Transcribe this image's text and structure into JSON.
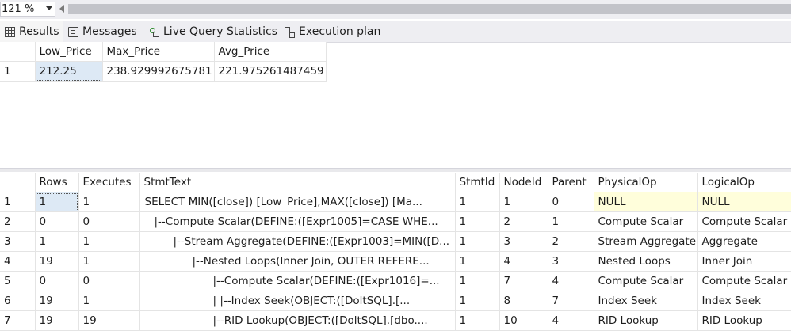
{
  "zoom": {
    "value": "121 %"
  },
  "tabs": [
    {
      "label": "Results",
      "icon": "grid-icon"
    },
    {
      "label": "Messages",
      "icon": "messages-icon"
    },
    {
      "label": "Live Query Statistics",
      "icon": "live-stats-icon"
    },
    {
      "label": "Execution plan",
      "icon": "execution-plan-icon"
    }
  ],
  "results": {
    "columns": [
      "Low_Price",
      "Max_Price",
      "Avg_Price"
    ],
    "rows": [
      {
        "num": "1",
        "cells": [
          "212.25",
          "238.929992675781",
          "221.975261487459"
        ]
      }
    ]
  },
  "plan": {
    "columns": [
      "Rows",
      "Executes",
      "StmtText",
      "StmtId",
      "NodeId",
      "Parent",
      "PhysicalOp",
      "LogicalOp"
    ],
    "rows": [
      {
        "num": "1",
        "cells": [
          "1",
          "1",
          "SELECT MIN([close]) [Low_Price],MAX([close]) [Ma...",
          "1",
          "1",
          "0",
          "NULL",
          "NULL"
        ]
      },
      {
        "num": "2",
        "cells": [
          "0",
          "0",
          "|--Compute Scalar(DEFINE:([Expr1005]=CASE WHE...",
          "1",
          "2",
          "1",
          "Compute Scalar",
          "Compute Scalar"
        ]
      },
      {
        "num": "3",
        "cells": [
          "1",
          "1",
          "|--Stream Aggregate(DEFINE:([Expr1003]=MIN([D...",
          "1",
          "3",
          "2",
          "Stream Aggregate",
          "Aggregate"
        ]
      },
      {
        "num": "4",
        "cells": [
          "19",
          "1",
          "|--Nested Loops(Inner Join, OUTER REFERE...",
          "1",
          "4",
          "3",
          "Nested Loops",
          "Inner Join"
        ]
      },
      {
        "num": "5",
        "cells": [
          "0",
          "0",
          "|--Compute Scalar(DEFINE:([Expr1016]=...",
          "1",
          "7",
          "4",
          "Compute Scalar",
          "Compute Scalar"
        ]
      },
      {
        "num": "6",
        "cells": [
          "19",
          "1",
          "|      |--Index Seek(OBJECT:([DoltSQL].[...",
          "1",
          "8",
          "7",
          "Index Seek",
          "Index Seek"
        ]
      },
      {
        "num": "7",
        "cells": [
          "19",
          "19",
          "|--RID Lookup(OBJECT:([DoltSQL].[dbo....",
          "1",
          "10",
          "4",
          "RID Lookup",
          "RID Lookup"
        ]
      }
    ]
  }
}
